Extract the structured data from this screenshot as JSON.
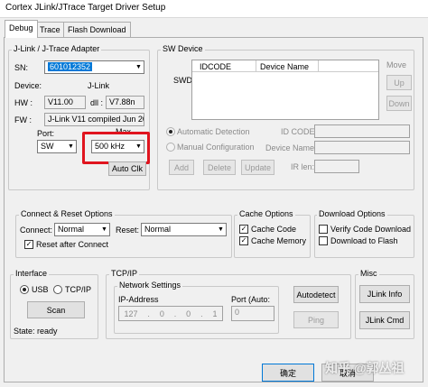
{
  "window": {
    "title": "Cortex JLink/JTrace Target Driver Setup"
  },
  "tabs": [
    "Debug",
    "Trace",
    "Flash Download"
  ],
  "adapter": {
    "legend": "J-Link / J-Trace Adapter",
    "sn_label": "SN:",
    "sn_value": "601012352",
    "device_label": "Device:",
    "device_value": "J-Link",
    "hw_label": "HW :",
    "hw_value": "V11.00",
    "dll_label": "dll :",
    "dll_value": "V7.88n",
    "fw_label": "FW :",
    "fw_value": "J-Link V11 compiled Jun 20",
    "port_label": "Port:",
    "port_value": "SW",
    "max_label": "Max",
    "max_value": "500 kHz",
    "auto_clk_label": "Auto Clk"
  },
  "sw_device": {
    "legend": "SW Device",
    "side_label": "SWDI",
    "columns": [
      "IDCODE",
      "Device Name"
    ],
    "move_label": "Move",
    "up_label": "Up",
    "down_label": "Down",
    "auto_detect_label": "Automatic Detection",
    "manual_config_label": "Manual Configuration",
    "id_code_label": "ID CODE:",
    "device_name_label": "Device Name:",
    "ir_len_label": "IR len:",
    "add_label": "Add",
    "delete_label": "Delete",
    "update_label": "Update"
  },
  "connect_reset": {
    "legend": "Connect & Reset Options",
    "connect_label": "Connect:",
    "connect_value": "Normal",
    "reset_label": "Reset:",
    "reset_value": "Normal",
    "reset_after_connect_label": "Reset after Connect"
  },
  "cache_options": {
    "legend": "Cache Options",
    "cache_code_label": "Cache Code",
    "cache_memory_label": "Cache Memory"
  },
  "download_options": {
    "legend": "Download Options",
    "verify_label": "Verify Code Download",
    "download_flash_label": "Download to Flash"
  },
  "interface": {
    "legend": "Interface",
    "usb_label": "USB",
    "tcpip_label": "TCP/IP",
    "scan_label": "Scan",
    "state_text": "State: ready"
  },
  "tcpip": {
    "legend": "TCP/IP",
    "network_legend": "Network Settings",
    "ip_label": "IP-Address",
    "ip_octets": [
      "127",
      "0",
      "0",
      "1"
    ],
    "port_label": "Port (Auto:",
    "port_value": "0",
    "autodetect_label": "Autodetect",
    "ping_label": "Ping"
  },
  "misc": {
    "legend": "Misc",
    "jlink_info_label": "JLink Info",
    "jlink_cmd_label": "JLink Cmd"
  },
  "footer": {
    "ok_label": "确定",
    "cancel_label": "取消"
  },
  "watermark": "知乎 @郭丛祖",
  "colors": {
    "highlight": "#e0141e",
    "selection": "#0078d7"
  }
}
